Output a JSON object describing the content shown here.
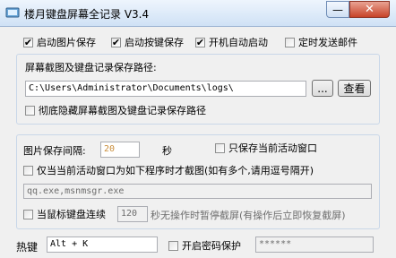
{
  "window": {
    "title": "楼月键盘屏幕全记录 V3.4",
    "minimize_glyph": "—",
    "close_glyph": "✕"
  },
  "options": {
    "save_image": "启动图片保存",
    "save_keys": "启动按键保存",
    "autostart": "开机自动启动",
    "timed_email": "定时发送邮件"
  },
  "path_group": {
    "label": "屏幕截图及键盘记录保存路径:",
    "path_value": "C:\\Users\\Administrator\\Documents\\logs\\",
    "browse_label": "...",
    "view_label": "查看",
    "hide_path_label": "彻底隐藏屏幕截图及键盘记录保存路径"
  },
  "image_group": {
    "interval_label": "图片保存间隔:",
    "interval_value": "20",
    "interval_unit": "秒",
    "active_only_label": "只保存当前活动窗口",
    "program_only_label": "仅当当前活动窗口为如下程序时才截图(如有多个,请用逗号隔开)",
    "program_list": "qq.exe,msnmsgr.exe",
    "idle_label": "当鼠标键盘连续",
    "idle_value": "120",
    "idle_suffix": "秒无操作时暂停截屏(有操作后立即恢复截屏)"
  },
  "hotkey": {
    "label": "热键",
    "value": "Alt + K",
    "password_label": "开启密码保护",
    "password_value": "******"
  },
  "checked": {
    "save_image": true,
    "save_keys": true,
    "autostart": true,
    "timed_email": false,
    "hide_path": false,
    "active_only": false,
    "program_only": false,
    "idle_pause": false,
    "password": false
  }
}
